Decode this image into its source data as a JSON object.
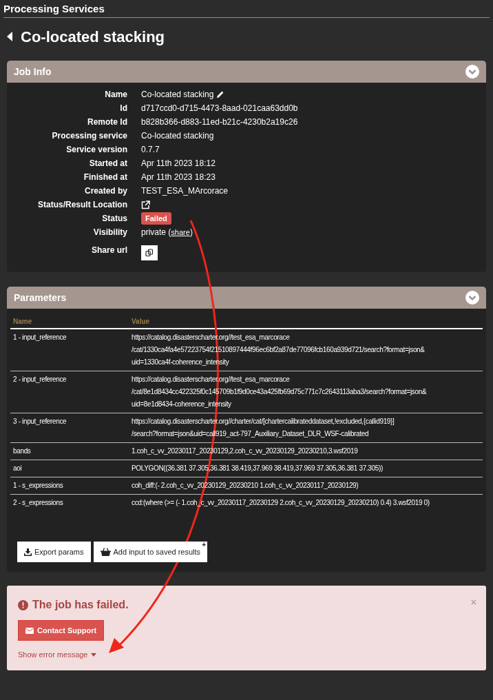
{
  "section_title": "Processing Services",
  "page_title": "Co-located stacking",
  "job_info": {
    "title": "Job Info",
    "fields": [
      {
        "kind": "editable",
        "label": "Name",
        "value": "Co-located stacking"
      },
      {
        "kind": "text",
        "label": "Id",
        "value": "d717ccd0-d715-4473-8aad-021caa63dd0b"
      },
      {
        "kind": "text",
        "label": "Remote Id",
        "value": "b828b366-d883-11ed-b21c-4230b2a19c26"
      },
      {
        "kind": "text",
        "label": "Processing service",
        "value": "Co-located stacking"
      },
      {
        "kind": "text",
        "label": "Service version",
        "value": "0.7.7"
      },
      {
        "kind": "text",
        "label": "Started at",
        "value": "Apr 11th 2023 18:12"
      },
      {
        "kind": "text",
        "label": "Finished at",
        "value": "Apr 11th 2023 18:23"
      },
      {
        "kind": "text",
        "label": "Created by",
        "value": "TEST_ESA_MArcorace"
      },
      {
        "kind": "link",
        "label": "Status/Result Location"
      },
      {
        "kind": "badge",
        "label": "Status",
        "value": "Failed"
      },
      {
        "kind": "visibility",
        "label": "Visibility",
        "value": "private (",
        "link": "share",
        "after": ")"
      },
      {
        "kind": "copy",
        "label": "Share url"
      }
    ]
  },
  "parameters": {
    "title": "Parameters",
    "columns": [
      "Name",
      "Value"
    ],
    "rows": [
      {
        "name": "1 - input_reference",
        "value": [
          "https://catalog.disasterscharter.org//test_esa_marcorace",
          "/cat/1330ca4fa4e57223754f21510897444f96ec6bf2a87de77096fcb160a939d721/search?format=json&",
          "uid=1330ca4f-coherence_intensity"
        ]
      },
      {
        "name": "2 - input_reference",
        "value": [
          "https://catalog.disasterscharter.org//test_esa_marcorace",
          "/cat/8e1d8434cc422325f0c145709b1f9d0ce43a425fb69d75c771c7c2643113aba3/search?format=json&",
          "uid=8e1d8434-coherence_intensity"
        ]
      },
      {
        "name": "3 - input_reference",
        "value": [
          "https://catalog.disasterscharter.org//charter/cat/[chartercalibrateddataset,!excluded,{callid919}]",
          "/search?format=json&uid=call919_act-797_Auxiliary_Dataset_DLR_WSF-calibrated"
        ]
      },
      {
        "name": "bands",
        "value": [
          "1.coh_c_vv_20230117_20230129,2.coh_c_vv_20230129_20230210,3.wsf2019"
        ]
      },
      {
        "name": "aoi",
        "value": [
          "POLYGON((36.381 37.305,36.381 38.419,37.969 38.419,37.969 37.305,36.381 37.305))"
        ]
      },
      {
        "name": "1 - s_expressions",
        "value": [
          "coh_diff:(- 2.coh_c_vv_20230129_20230210 1.coh_c_vv_20230117_20230129)"
        ]
      },
      {
        "name": "2 - s_expressions",
        "value": [
          "ccd:(where (>= (- 1.coh_c_vv_20230117_20230129 2.coh_c_vv_20230129_20230210) 0.4) 3.wsf2019 0)"
        ]
      }
    ],
    "buttons": [
      {
        "kind": "export",
        "label": "Export params"
      },
      {
        "kind": "basket",
        "label": "Add input to saved results",
        "badge": "+"
      }
    ]
  },
  "alert": {
    "title": "The job has failed.",
    "close": "×",
    "button": "Contact Support",
    "toggle": "Show error message",
    "expanded": false
  }
}
